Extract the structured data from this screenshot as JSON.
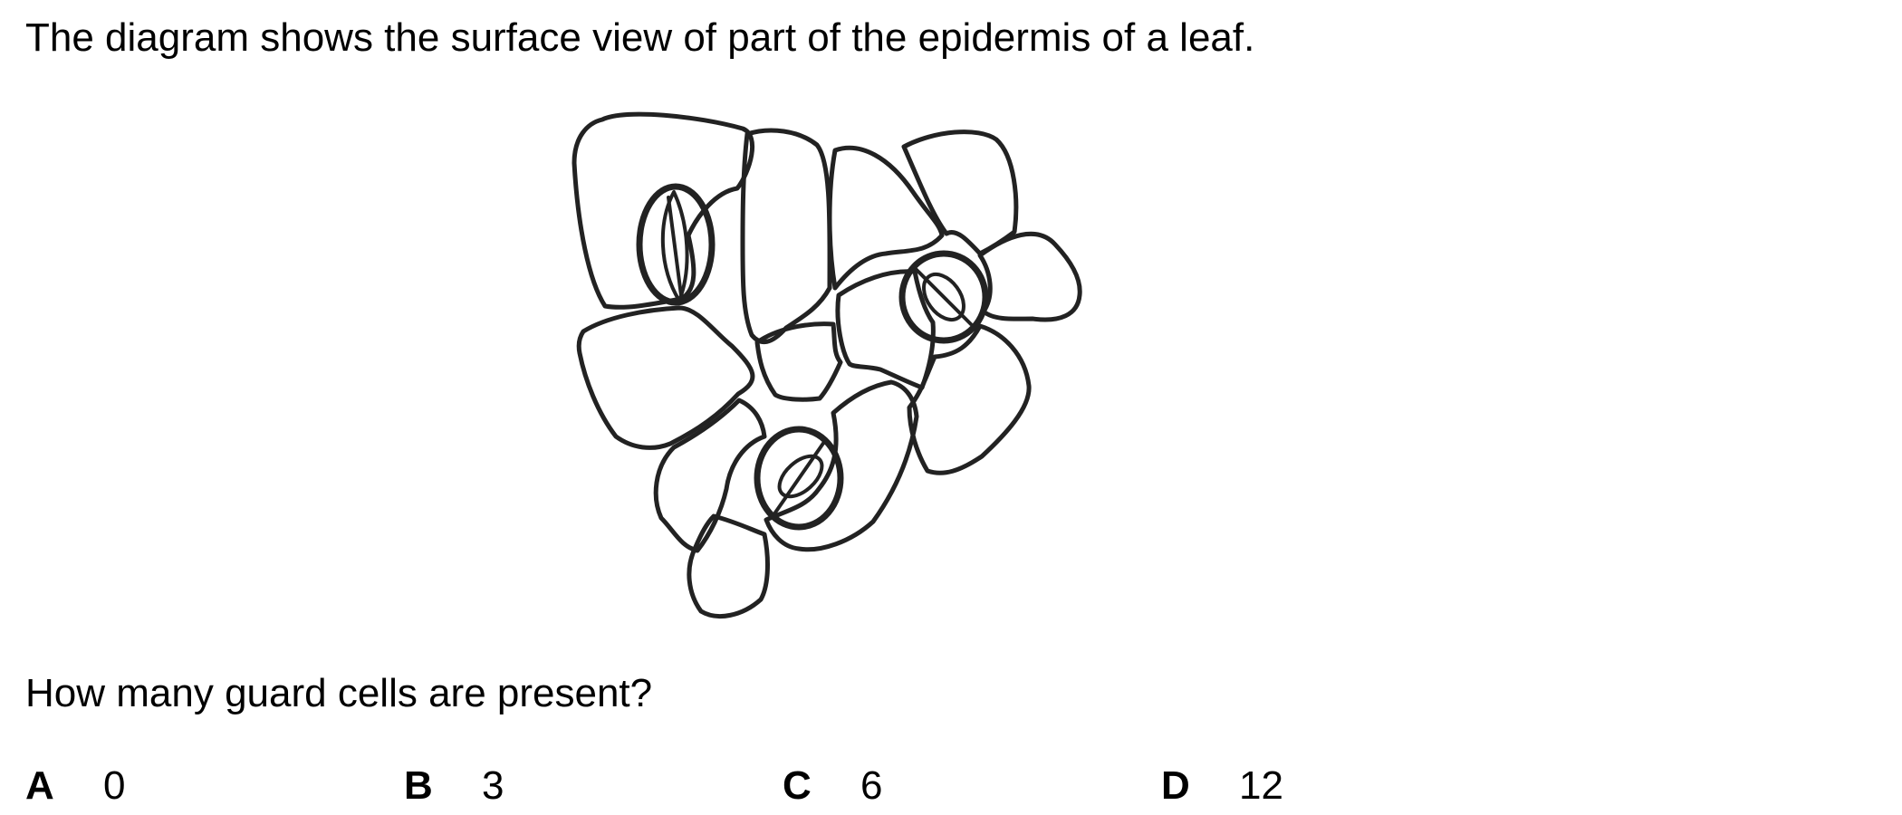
{
  "stem": "The diagram shows the surface view of part of the epidermis of a leaf.",
  "question": "How many guard cells are present?",
  "options": [
    {
      "letter": "A",
      "value": "0"
    },
    {
      "letter": "B",
      "value": "3"
    },
    {
      "letter": "C",
      "value": "6"
    },
    {
      "letter": "D",
      "value": "12"
    }
  ]
}
